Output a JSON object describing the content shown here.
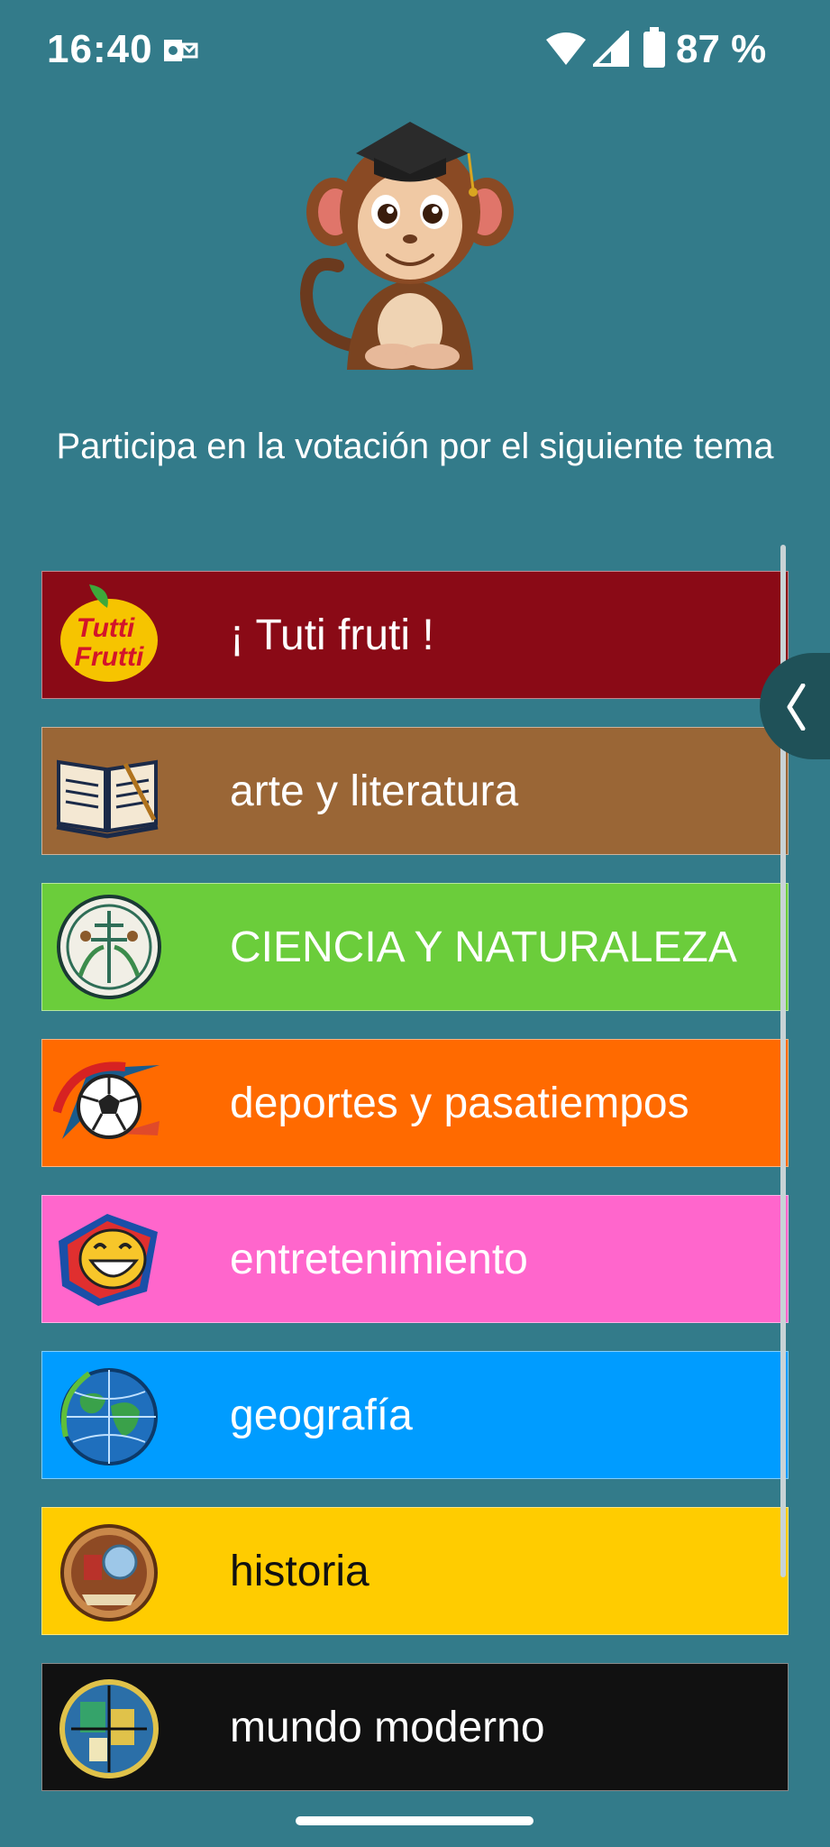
{
  "status_bar": {
    "time": "16:40",
    "battery": "87 %"
  },
  "prompt": "Participa en la votación por el siguiente tema",
  "topics": [
    {
      "label": "¡ Tuti fruti !",
      "color": "#8a0a16",
      "icon": "tutti-frutti-icon"
    },
    {
      "label": "arte y literatura",
      "color": "#9a6636",
      "icon": "open-book-icon"
    },
    {
      "label": "CIENCIA Y NATURALEZA",
      "color": "#6bcd3b",
      "icon": "science-nature-icon"
    },
    {
      "label": "deportes y pasatiempos",
      "color": "#ff6a00",
      "icon": "soccer-ball-icon"
    },
    {
      "label": "entretenimiento",
      "color": "#ff66cc",
      "icon": "laughing-face-icon"
    },
    {
      "label": "geografía",
      "color": "#009cff",
      "icon": "globe-icon"
    },
    {
      "label": "historia",
      "color": "#ffcc00",
      "icon": "history-icon"
    },
    {
      "label": "mundo moderno",
      "color": "#111111",
      "icon": "modern-world-icon"
    }
  ]
}
